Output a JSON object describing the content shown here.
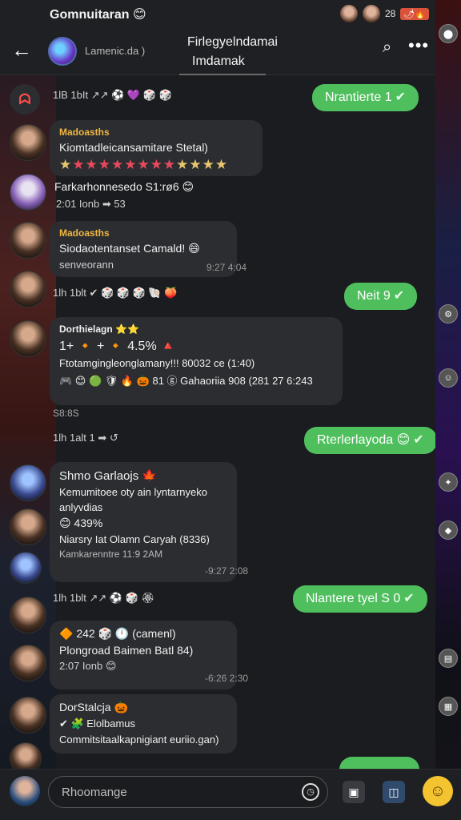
{
  "status": {
    "title": "Gomnuitaran 😊",
    "time": "28",
    "badge": "🌶🔥"
  },
  "header": {
    "sub": "Lamenic.da )",
    "title": "Firlegyelndamai",
    "title2": "Imdamak"
  },
  "messages": {
    "r0": {
      "meta": "1lB  1bIt  ↗↗ ⚽ 💜 🎲 🎲"
    },
    "o1": {
      "text": "Nrantierte  1",
      "check": "✔"
    },
    "m1": {
      "name": "Madoasths",
      "line": "Kiomtadleicansamitare Stetal)"
    },
    "m2": {
      "line": "Farkarhonnesedo S1:rø6 😊",
      "meta": "2:01  Ionb  ➡ 53"
    },
    "m3": {
      "name": "Madoasths",
      "line": "Siodaotentanset Camald! 😄",
      "meta": "senveorann",
      "time": "9:27     4:04"
    },
    "r1": {
      "meta": "1lh    1blt  ✔ 🎲 🎲 🎲 🐚 🍑"
    },
    "o2": {
      "text": "Neit  9",
      "check": "✔"
    },
    "m4": {
      "name": "Dorthielagn ⭐⭐",
      "line1": "1+ 🔸 + 🔸 4.5% 🔺",
      "line2": "Ftotamgingleonglamany!!! 80032 ce (1:40)",
      "line3": "🎮 😊 🟢 🛡 🔥 🎃 81  ⓖ Gahaoriia 908  (281 27 6:243"
    },
    "d1": {
      "text": "S8:8S"
    },
    "r2": {
      "meta": "1lh    1alt   1  ➡ ↺"
    },
    "o3": {
      "text": "Rterlerlayoda 😊",
      "check": "✔"
    },
    "m5": {
      "name": "Shmo Garlaojs 🍁",
      "line1": "Kemumitoee oty ain lyntarnyeko",
      "line2": "anlyvdias",
      "line3": "😊 439%",
      "line4": "Niarsry Iat Olamn Caryah (8336)",
      "meta": "Kamkarenntre  11:9 2AM",
      "time": "-9:27     2:08"
    },
    "r3": {
      "meta": "1lh    1blt  ↗↗ ⚽ 🎲 🏵"
    },
    "o4": {
      "text": "Nlantere tyel  S  0",
      "check": "✔"
    },
    "m6": {
      "line1": "🔶 242  🎲  🕛  (camenl)",
      "line2": "Plongroad Baimen Batl 84)",
      "meta": "2:07   Ionb  😊",
      "time": "-6:26     2:30"
    },
    "m7": {
      "name": "DorStalcja 🎃",
      "line1": "✔  🧩  Elolbamus",
      "line2": "Commitsitaalkapnigiant euriio.gan)"
    }
  },
  "input": {
    "placeholder": "Rhoomange"
  },
  "colors": {
    "accent": "#4fbf5e",
    "bubble": "#2b2d31",
    "name": "#f0b640"
  }
}
